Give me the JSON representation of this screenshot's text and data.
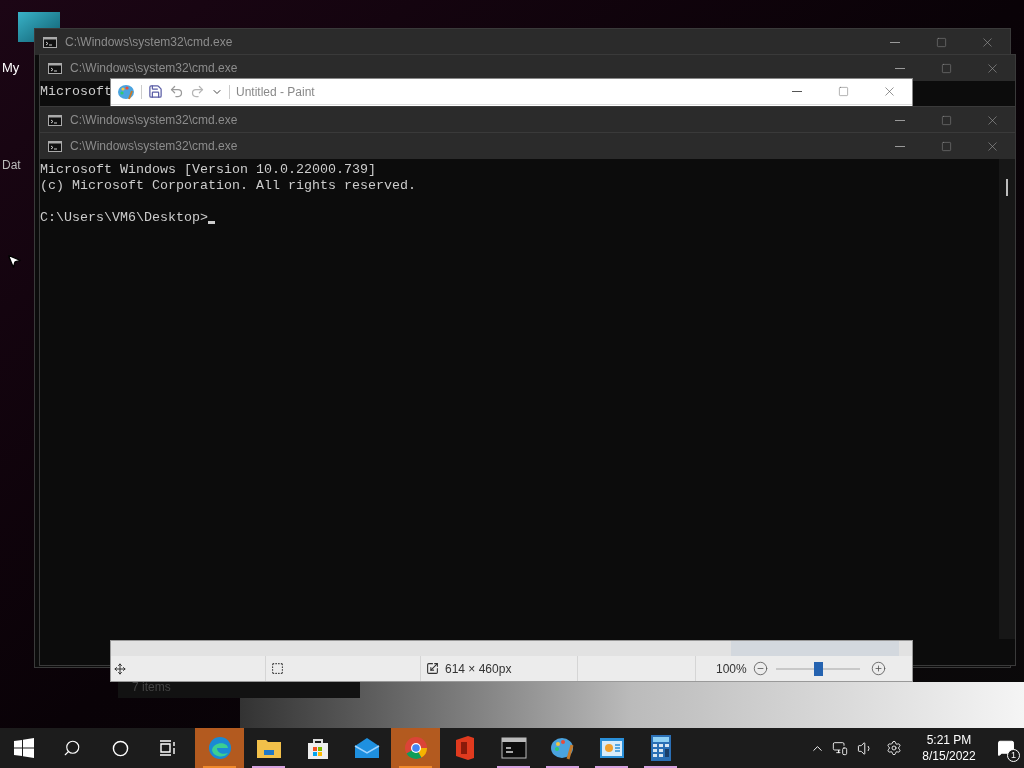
{
  "desktop_icons": [
    {
      "label": "My"
    },
    {
      "label": "Dat"
    }
  ],
  "background_window": {
    "status": "7 items"
  },
  "windows": [
    {
      "kind": "cmd",
      "title": "C:\\Windows\\system32\\cmd.exe"
    },
    {
      "kind": "cmd",
      "title": "C:\\Windows\\system32\\cmd.exe",
      "paragraphs": [
        [
          "Microsoft"
        ]
      ]
    },
    {
      "kind": "paint",
      "title": "Untitled - Paint",
      "status": {
        "size": "614 × 460px",
        "zoom": "100%",
        "zoom_slider": {
          "level": 0.5
        }
      }
    },
    {
      "kind": "cmd",
      "title": "C:\\Windows\\system32\\cmd.exe"
    },
    {
      "kind": "cmd",
      "title": "C:\\Windows\\system32\\cmd.exe",
      "paragraphs": [
        [
          "Microsoft Windows [Version 10.0.22000.739]",
          "(c) Microsoft Corporation. All rights reserved."
        ],
        [
          "C:\\Users\\VM6\\Desktop>"
        ]
      ],
      "cursor": true
    }
  ],
  "taskbar": {
    "apps": [
      {
        "kind": "edge",
        "flashing": true,
        "running": true
      },
      {
        "kind": "explorer",
        "flashing": false,
        "running": true
      },
      {
        "kind": "store",
        "flashing": false,
        "running": false
      },
      {
        "kind": "mail",
        "flashing": false,
        "running": false
      },
      {
        "kind": "chrome",
        "flashing": true,
        "running": true
      },
      {
        "kind": "office",
        "flashing": false,
        "running": false
      },
      {
        "kind": "terminal",
        "flashing": false,
        "running": true
      },
      {
        "kind": "paint",
        "flashing": false,
        "running": true
      },
      {
        "kind": "control",
        "flashing": false,
        "running": true
      },
      {
        "kind": "calculator",
        "flashing": false,
        "running": true
      }
    ],
    "clock": {
      "time": "5:21 PM",
      "date": "8/15/2022"
    },
    "notification_count": "1"
  }
}
